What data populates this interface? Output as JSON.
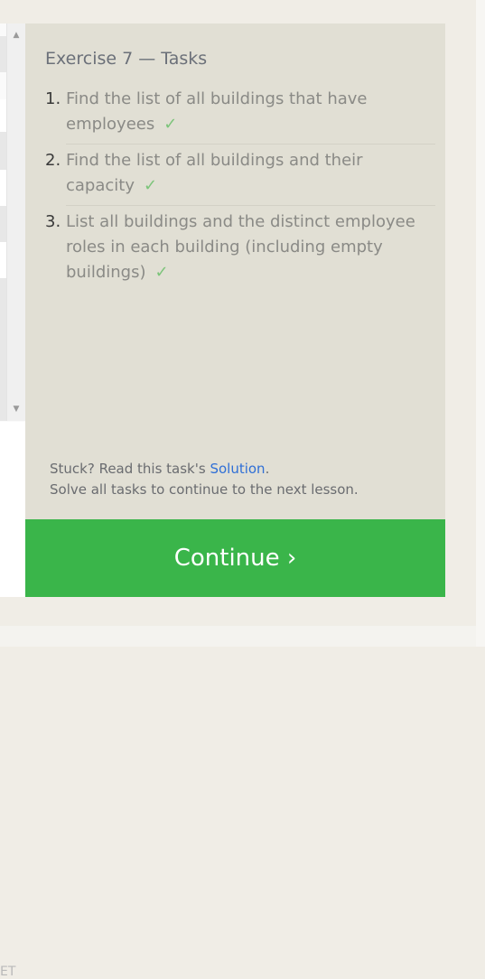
{
  "exercise": {
    "title": "Exercise 7 — Tasks",
    "tasks": [
      {
        "number": "1.",
        "text": "Find the list of all buildings that have employees",
        "check": "✓"
      },
      {
        "number": "2.",
        "text": "Find the list of all buildings and their capacity",
        "check": "✓"
      },
      {
        "number": "3.",
        "text": "List all buildings and the distinct employee roles in each building (including empty buildings)",
        "check": "✓"
      }
    ],
    "stuck_prefix": "Stuck? Read this task's ",
    "solution_link": "Solution",
    "stuck_suffix": ".",
    "solve_all": "Solve all tasks to continue to the next lesson.",
    "continue_label": "Continue ›"
  },
  "left_panel": {
    "truncated_text": "ET"
  },
  "colors": {
    "panel_bg": "#e1dfd4",
    "continue_bg": "#3ab54a",
    "check_color": "#7cc47a",
    "link_color": "#2f6fd6"
  }
}
